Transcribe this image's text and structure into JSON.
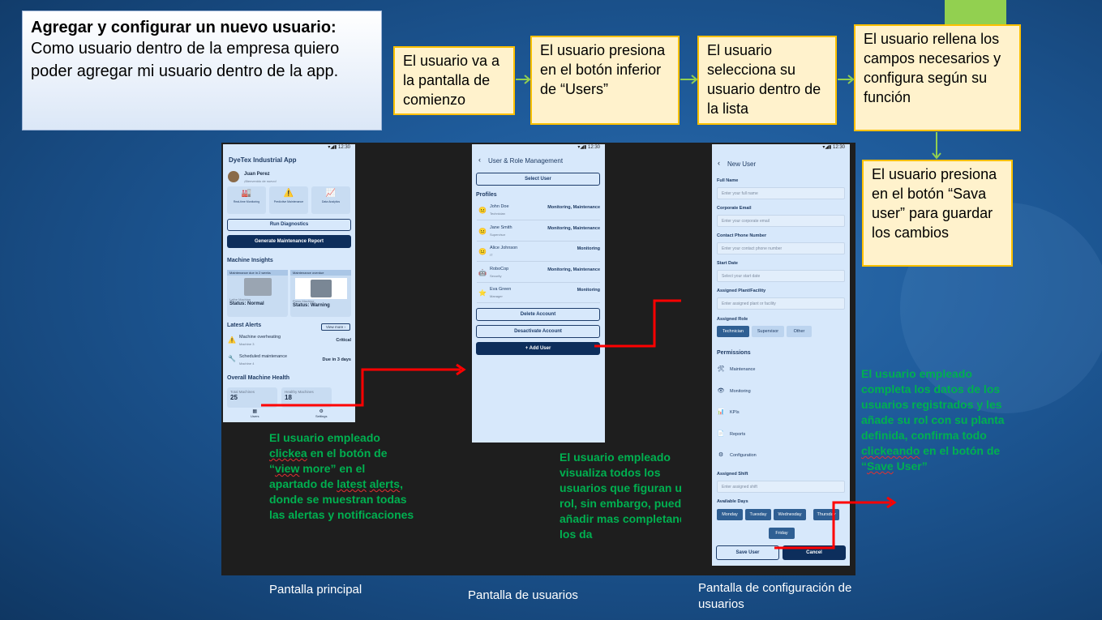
{
  "title": {
    "heading": "Agregar y configurar un nuevo usuario:",
    "story": "Como usuario dentro de la empresa quiero poder agregar mi usuario dentro de la app."
  },
  "steps": [
    "El usuario va a la pantalla de comienzo",
    "El usuario presiona en el botón inferior de “Users”",
    "El usuario selecciona su usuario dentro de la lista",
    "El usuario rellena los campos necesarios y configura según su función",
    "El usuario presiona en el botón “Sava user” para guardar los cambios"
  ],
  "screen1": {
    "status_time": "12:30",
    "app_title": "DyeTex Industrial App",
    "user_name": "Juan Perez",
    "user_greeting": "¡Bienvenido de nuevo!",
    "features": [
      "Real-time Monitoring",
      "Predictive Maintenance",
      "Data Analytics"
    ],
    "run_diagnostics": "Run Diagnostics",
    "generate_report": "Generate Maintenance Report",
    "machine_insights": "Machine Insights",
    "machines": [
      {
        "badge": "Maintenance due in 2 weeks",
        "name": "Lathe Machine",
        "status": "Status: Normal"
      },
      {
        "badge": "Maintenance overdue",
        "name": "Press Machine",
        "status": "Status: Warning"
      }
    ],
    "latest_alerts": "Latest Alerts",
    "view_more": "View more",
    "alerts": [
      {
        "title": "Machine overheating",
        "sub": "Machine 3",
        "level": "Critical"
      },
      {
        "title": "Scheduled maintenance",
        "sub": "Machine 4",
        "level": "Due in 3 days"
      }
    ],
    "overall_health": "Overall Machine Health",
    "total_label": "Total Machines",
    "total_value": "25",
    "healthy_label": "Healthy Machines",
    "healthy_value": "18",
    "nav_users": "Users",
    "nav_settings": "Settings"
  },
  "screen2": {
    "status_time": "12:30",
    "title": "User & Role Management",
    "select_user": "Select User",
    "profiles_label": "Profiles",
    "profiles": [
      {
        "name": "John Doe",
        "role": "Technician",
        "functions": "Monitoring, Maintenance",
        "avatar": "😐"
      },
      {
        "name": "Jane Smith",
        "role": "Supervisor",
        "functions": "Monitoring, Maintenance",
        "avatar": "😐"
      },
      {
        "name": "Alice Johnson",
        "role": "IT",
        "functions": "Monitoring",
        "avatar": "😐"
      },
      {
        "name": "RoboCop",
        "role": "Security",
        "functions": "Monitoring, Maintenance",
        "avatar": "🤖"
      },
      {
        "name": "Eva Green",
        "role": "Manager",
        "functions": "Monitoring",
        "avatar": "⭐"
      }
    ],
    "delete_account": "Delete Account",
    "deactivate_account": "Desactivate Account",
    "add_user": "+ Add User"
  },
  "screen3": {
    "status_time": "12:30",
    "title": "New User",
    "full_name_label": "Full Name",
    "full_name_ph": "Enter your full name",
    "email_label": "Corporate Email",
    "email_ph": "Enter your corporate email",
    "phone_label": "Contact Phone Number",
    "phone_ph": "Enter your contact phone number",
    "start_label": "Start Date",
    "start_ph": "Select your start date",
    "plant_label": "Assigned Plant/Facility",
    "plant_ph": "Enter assigned plant or facility",
    "role_label": "Assigned Role",
    "roles": [
      "Technician",
      "Supervisor",
      "Other"
    ],
    "permissions_label": "Permissions",
    "permissions": [
      "Maintenance",
      "Monitoring",
      "KPIs",
      "Reports",
      "Configuration"
    ],
    "shift_label": "Assigned Shift",
    "shift_ph": "Enter assigned shift",
    "days_label": "Available Days",
    "days": [
      "Monday",
      "Tuesday",
      "Wednesday",
      "Thursday",
      "Friday"
    ],
    "save_user": "Save User",
    "cancel": "Cancel"
  },
  "notes": {
    "note1": [
      "El usuario empleado ",
      "clickea",
      " en el botón de ",
      "“",
      "view",
      " more” en el apartado de ",
      "latest",
      " ",
      "alerts",
      ", donde se muestran todas las alertas y notificaciones"
    ],
    "note2": "El usuario empleado visualiza todos los usuarios que figuran un rol, sin embargo, puede añadir mas completando los da",
    "note3": [
      "El usuario empleado completa los datos de los usuarios registrados y les añade su rol con su planta definida, confirma todo ",
      "clickeando",
      " en el botón de “",
      "Save",
      " User”"
    ]
  },
  "captions": [
    "Pantalla principal",
    "Pantalla de usuarios",
    "Pantalla de configuración de usuarios"
  ],
  "colors": {
    "step_fill": "#fff2cc",
    "step_border": "#ffc000",
    "connector_red": "#ff0000",
    "note_green": "#00b050",
    "flow_arrow": "#92d050"
  }
}
